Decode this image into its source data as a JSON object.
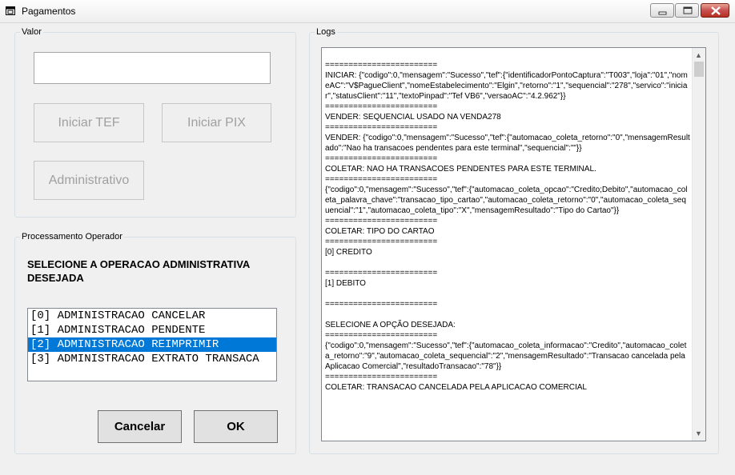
{
  "window": {
    "title": "Pagamentos"
  },
  "valor": {
    "legend": "Valor",
    "input_value": "",
    "buttons": {
      "iniciar_tef": "Iniciar TEF",
      "iniciar_pix": "Iniciar PIX",
      "administrativo": "Administrativo"
    }
  },
  "processamento": {
    "legend": "Processamento Operador",
    "prompt": "SELECIONE A OPERACAO ADMINISTRATIVA DESEJADA",
    "options": [
      "[0] ADMINISTRACAO CANCELAR",
      "[1] ADMINISTRACAO PENDENTE",
      "[2] ADMINISTRACAO REIMPRIMIR",
      "[3] ADMINISTRACAO EXTRATO TRANSACA"
    ],
    "selected_index": 2,
    "cancel_label": "Cancelar",
    "ok_label": "OK"
  },
  "logs": {
    "legend": "Logs",
    "text": "========================\nINICIAR: {\"codigo\":0,\"mensagem\":\"Sucesso\",\"tef\":{\"identificadorPontoCaptura\":\"T003\",\"loja\":\"01\",\"nomeAC\":\"V$PagueClient\",\"nomeEstabelecimento\":\"Elgin\",\"retorno\":\"1\",\"sequencial\":\"278\",\"servico\":\"iniciar\",\"statusClient\":\"11\",\"textoPinpad\":\"Tef VB6\",\"versaoAC\":\"4.2.962\"}}\n========================\nVENDER: SEQUENCIAL USADO NA VENDA278\n========================\nVENDER: {\"codigo\":0,\"mensagem\":\"Sucesso\",\"tef\":{\"automacao_coleta_retorno\":\"0\",\"mensagemResultado\":\"Nao ha transacoes pendentes para este terminal\",\"sequencial\":\"\"}}\n========================\nCOLETAR: NAO HA TRANSACOES PENDENTES PARA ESTE TERMINAL.\n========================\n{\"codigo\":0,\"mensagem\":\"Sucesso\",\"tef\":{\"automacao_coleta_opcao\":\"Credito;Debito\",\"automacao_coleta_palavra_chave\":\"transacao_tipo_cartao\",\"automacao_coleta_retorno\":\"0\",\"automacao_coleta_sequencial\":\"1\",\"automacao_coleta_tipo\":\"X\",\"mensagemResultado\":\"Tipo do Cartao\"}}\n========================\nCOLETAR: TIPO DO CARTAO\n========================\n[0] CREDITO\n\n========================\n[1] DEBITO\n\n========================\n\nSELECIONE A OPÇÃO DESEJADA:\n========================\n{\"codigo\":0,\"mensagem\":\"Sucesso\",\"tef\":{\"automacao_coleta_informacao\":\"Credito\",\"automacao_coleta_retorno\":\"9\",\"automacao_coleta_sequencial\":\"2\",\"mensagemResultado\":\"Transacao cancelada pela Aplicacao Comercial\",\"resultadoTransacao\":\"78\"}}\n========================\nCOLETAR: TRANSACAO CANCELADA PELA APLICACAO COMERCIAL"
  }
}
